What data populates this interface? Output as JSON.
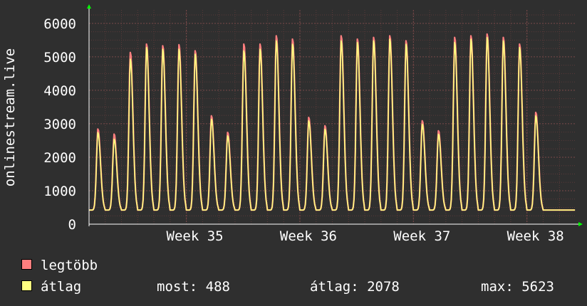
{
  "chart_data": {
    "type": "line",
    "ylabel": "onlinestream.live",
    "ylim": [
      0,
      6400
    ],
    "yticks": [
      0,
      1000,
      2000,
      3000,
      4000,
      5000,
      6000
    ],
    "xlim": [
      0,
      30
    ],
    "xtick_labels": [
      {
        "x": 6.0,
        "label": "Week 35"
      },
      {
        "x": 13.0,
        "label": "Week 36"
      },
      {
        "x": 20.0,
        "label": "Week 37"
      },
      {
        "x": 27.0,
        "label": "Week 38"
      }
    ],
    "days_x": [
      0.5,
      1.5,
      2.5,
      3.5,
      4.5,
      5.5,
      6.5,
      7.5,
      8.5,
      9.5,
      10.5,
      11.5,
      12.5,
      13.5,
      14.5,
      15.5,
      16.5,
      17.5,
      18.5,
      19.5,
      20.5,
      21.5,
      22.5,
      23.5,
      24.5,
      25.5,
      26.5,
      27.5,
      28.5,
      29.5
    ],
    "series": [
      {
        "name": "legtöbb",
        "color": "#ff7f7f",
        "daily_peaks": [
          2850,
          2700,
          5150,
          5400,
          5350,
          5380,
          5200,
          3250,
          2750,
          5400,
          5400,
          5650,
          5550,
          3200,
          2950,
          5650,
          5550,
          5600,
          5650,
          5500,
          3100,
          2800,
          5600,
          5650,
          5700,
          5600,
          5400,
          3350,
          0,
          0
        ]
      },
      {
        "name": "átlag",
        "color": "#ffff80",
        "daily_peaks": [
          2750,
          2550,
          4950,
          5300,
          5250,
          5250,
          5100,
          3150,
          2650,
          5200,
          5250,
          5500,
          5400,
          3100,
          2850,
          5500,
          5450,
          5500,
          5550,
          5400,
          3000,
          2700,
          5450,
          5550,
          5600,
          5500,
          5300,
          3250,
          0,
          0
        ]
      }
    ],
    "trough": 420,
    "grid": true
  },
  "legend": {
    "max_label": "legtöbb",
    "avg_label": "átlag"
  },
  "stats": {
    "now": "most: 488",
    "avg": "átlag: 2078",
    "max": "max: 5623"
  },
  "colors": {
    "background": "#2f2f2f",
    "grid_minor": "#5a3a3a",
    "grid_major": "#7a4a4a",
    "axis": "#ffffff",
    "arrow": "#00ff00"
  }
}
